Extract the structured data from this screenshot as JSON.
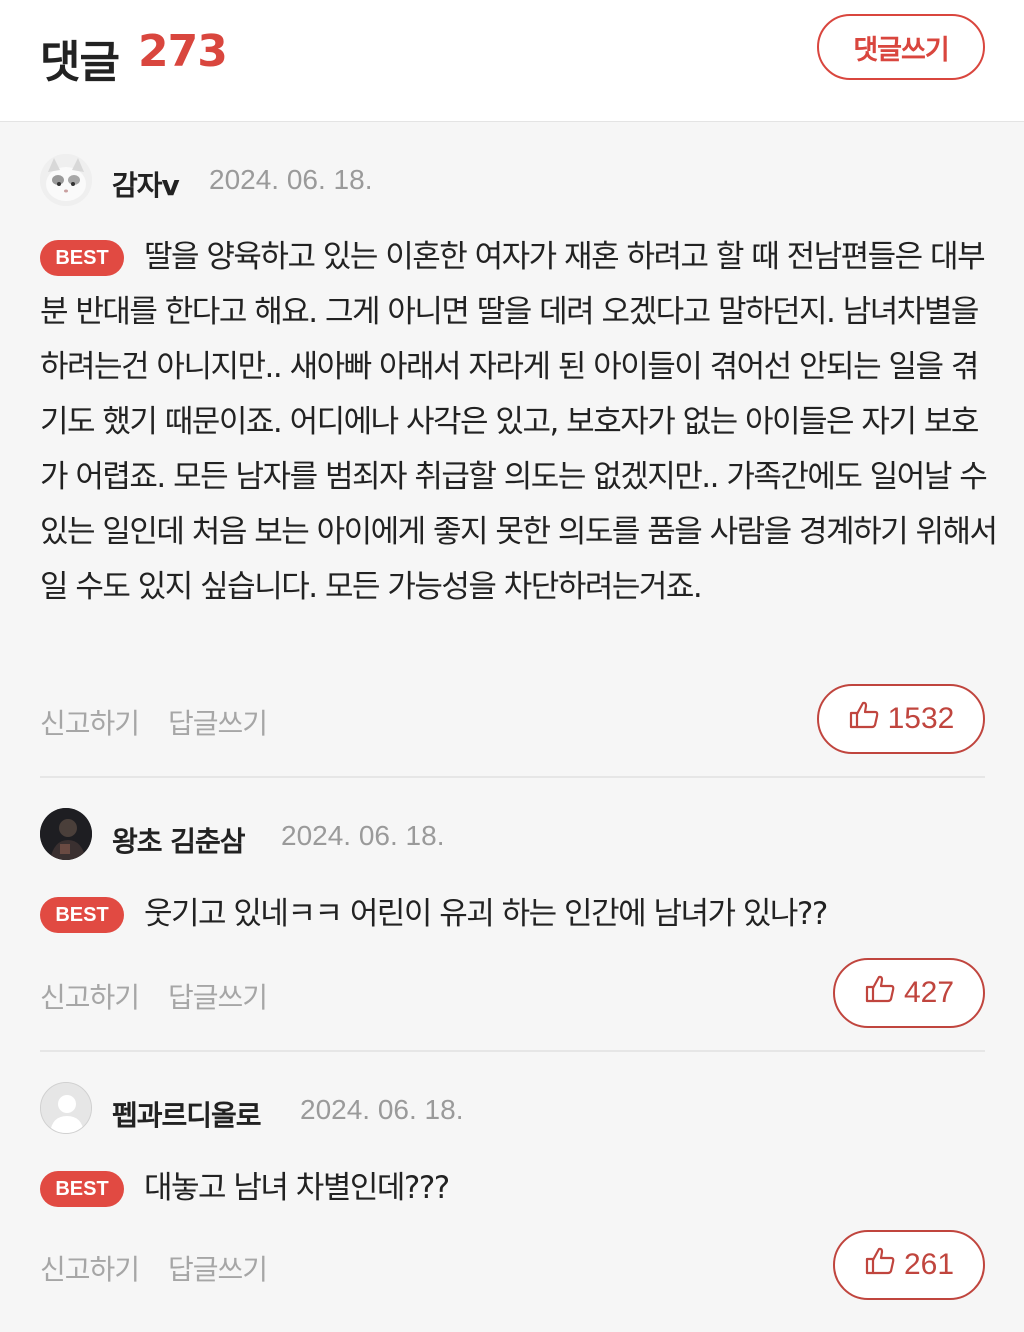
{
  "header": {
    "title": "댓글",
    "count": "273",
    "write_button": "댓글쓰기"
  },
  "colors": {
    "accent": "#d9463e",
    "best_badge": "#e14a42",
    "muted_text": "#9a9a9a",
    "background": "#f6f6f6"
  },
  "comments": [
    {
      "username": "감자v",
      "date": "2024. 06. 18.",
      "badge": "BEST",
      "text": "딸을 양육하고 있는 이혼한 여자가 재혼 하려고 할 때 전남편들은 대부분 반대를 한다고 해요. 그게 아니면 딸을 데려 오겠다고 말하던지. 남녀차별을 하려는건 아니지만.. 새아빠 아래서 자라게 된 아이들이 겪어선 안되는 일을 겪기도 했기 때문이죠. 어디에나 사각은 있고, 보호자가 없는 아이들은 자기 보호가 어렵죠. 모든 남자를 범죄자 취급할 의도는 없겠지만.. 가족간에도 일어날 수 있는 일인데 처음 보는 아이에게 좋지 못한 의도를 품을 사람을 경계하기 위해서일 수도 있지 싶습니다. 모든 가능성을 차단하려는거죠.",
      "report": "신고하기",
      "reply": "답글쓰기",
      "likes": "1532",
      "avatar_icon": "cat-avatar-icon"
    },
    {
      "username": "왕초 김춘삼",
      "date": "2024. 06. 18.",
      "badge": "BEST",
      "text": "웃기고 있네ㅋㅋ 어린이 유괴 하는 인간에 남녀가 있나??",
      "report": "신고하기",
      "reply": "답글쓰기",
      "likes": "427",
      "avatar_icon": "person-photo-avatar-icon"
    },
    {
      "username": "펩과르디올로",
      "date": "2024. 06. 18.",
      "badge": "BEST",
      "text": "대놓고 남녀 차별인데???",
      "report": "신고하기",
      "reply": "답글쓰기",
      "likes": "261",
      "avatar_icon": "default-user-avatar-icon"
    }
  ],
  "icons": {
    "like": "thumbs-up-icon"
  }
}
